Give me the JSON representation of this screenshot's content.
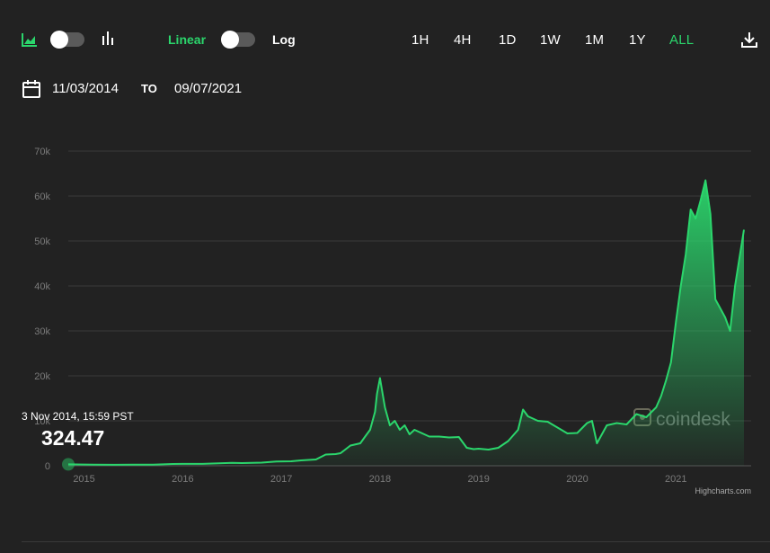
{
  "toolbar": {
    "linear_label": "Linear",
    "log_label": "Log",
    "ranges": [
      "1H",
      "4H",
      "1D",
      "1W",
      "1M",
      "1Y",
      "ALL"
    ],
    "active_range": "ALL",
    "icons": {
      "area": "area-chart-icon",
      "bars": "candlestick-chart-icon",
      "download": "download-icon",
      "calendar": "calendar-icon"
    }
  },
  "date_range": {
    "from": "11/03/2014",
    "to_label": "TO",
    "to": "09/07/2021"
  },
  "tooltip": {
    "date": "3 Nov 2014, 15:59 PST",
    "price": "324.47"
  },
  "watermark": "coindesk",
  "credits": "Highcharts.com",
  "colors": {
    "accent": "#2bd66c",
    "background": "#222222",
    "grid": "#3a3a3a",
    "axis_text": "#7a7a7a"
  },
  "chart_data": {
    "type": "area",
    "title": "",
    "xlabel": "",
    "ylabel": "",
    "ylim": [
      0,
      70000
    ],
    "xlim": [
      2014.84,
      2021.69
    ],
    "yticks": [
      0,
      10000,
      20000,
      30000,
      40000,
      50000,
      60000,
      70000
    ],
    "ytick_labels": [
      "0",
      "10k",
      "20k",
      "30k",
      "40k",
      "50k",
      "60k",
      "70k"
    ],
    "xticks": [
      2015,
      2016,
      2017,
      2018,
      2019,
      2020,
      2021
    ],
    "xtick_labels": [
      "2015",
      "2016",
      "2017",
      "2018",
      "2019",
      "2020",
      "2021"
    ],
    "grid": true,
    "legend": "none",
    "series": [
      {
        "x": [
          2014.84,
          2015.0,
          2015.1,
          2015.3,
          2015.5,
          2015.7,
          2015.9,
          2016.0,
          2016.2,
          2016.4,
          2016.5,
          2016.6,
          2016.8,
          2016.95,
          2017.1,
          2017.2,
          2017.35,
          2017.45,
          2017.55,
          2017.6,
          2017.7,
          2017.8,
          2017.85,
          2017.9,
          2017.95,
          2017.97,
          2018.0,
          2018.05,
          2018.1,
          2018.15,
          2018.2,
          2018.25,
          2018.3,
          2018.35,
          2018.4,
          2018.5,
          2018.6,
          2018.7,
          2018.8,
          2018.88,
          2018.95,
          2019.0,
          2019.1,
          2019.2,
          2019.3,
          2019.4,
          2019.45,
          2019.5,
          2019.6,
          2019.7,
          2019.8,
          2019.9,
          2020.0,
          2020.1,
          2020.15,
          2020.2,
          2020.25,
          2020.3,
          2020.4,
          2020.5,
          2020.6,
          2020.7,
          2020.8,
          2020.85,
          2020.9,
          2020.95,
          2021.0,
          2021.05,
          2021.1,
          2021.15,
          2021.2,
          2021.25,
          2021.3,
          2021.35,
          2021.4,
          2021.45,
          2021.5,
          2021.55,
          2021.6,
          2021.65,
          2021.69
        ],
        "y": [
          324,
          280,
          250,
          230,
          260,
          240,
          400,
          430,
          420,
          580,
          650,
          600,
          700,
          950,
          1000,
          1200,
          1400,
          2500,
          2600,
          2800,
          4500,
          5000,
          6500,
          8000,
          12000,
          16000,
          19500,
          13000,
          9000,
          10000,
          8000,
          9000,
          7000,
          8000,
          7500,
          6500,
          6500,
          6300,
          6400,
          4000,
          3700,
          3800,
          3600,
          4000,
          5500,
          8000,
          12500,
          11000,
          10000,
          9800,
          8500,
          7200,
          7300,
          9500,
          10000,
          5000,
          7000,
          9000,
          9500,
          9200,
          11500,
          10800,
          13000,
          15500,
          19000,
          23000,
          32000,
          40000,
          47000,
          57000,
          55000,
          59000,
          63500,
          56000,
          37000,
          35000,
          33000,
          30000,
          40000,
          47000,
          52500
        ]
      }
    ]
  }
}
